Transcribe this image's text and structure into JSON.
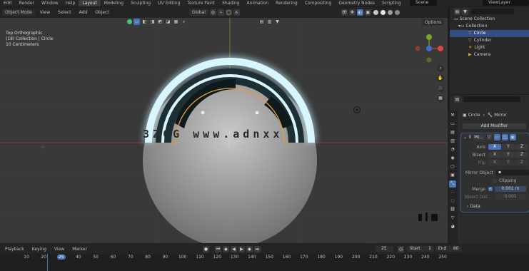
{
  "menu": {
    "items": [
      "Edit",
      "Render",
      "Window",
      "Help"
    ],
    "workspaces": [
      "Layout",
      "Modeling",
      "Sculpting",
      "UV Editing",
      "Texture Paint",
      "Shading",
      "Animation",
      "Rendering",
      "Compositing",
      "Geometry Nodes",
      "Scripting"
    ],
    "active_workspace": "Layout",
    "scene": "Scene",
    "view_layer": "ViewLayer"
  },
  "viewport_header": {
    "mode": "Object Mode",
    "menus": [
      "View",
      "Select",
      "Add",
      "Object"
    ],
    "transform_orientation": "Global",
    "options": "Options"
  },
  "viewport_overlay": {
    "line1": "Top Orthographic",
    "line2": "(18) Collection | Circle",
    "line3": "10 Centimeters",
    "watermark": "3ZCG www.adnxx"
  },
  "outliner": {
    "root": "Scene Collection",
    "collection": "Collection",
    "items": [
      {
        "name": "Circle",
        "selected": true
      },
      {
        "name": "Cylinder",
        "selected": false
      },
      {
        "name": "Light",
        "selected": false
      },
      {
        "name": "Camera",
        "selected": false
      }
    ]
  },
  "properties": {
    "breadcrumb_object": "Circle",
    "breadcrumb_modifier": "Mirror",
    "add_modifier": "Add Modifier",
    "modifier_name": "Mi...",
    "axis_label": "Axis",
    "bisect_label": "Bisect",
    "flip_label": "Flip",
    "axes": [
      "X",
      "Y",
      "Z"
    ],
    "mirror_object_label": "Mirror Object",
    "clipping_label": "Clipping",
    "merge_label": "Merge",
    "merge_value": "0.001 m",
    "bisect_distance_label": "Bisect Dist...",
    "bisect_distance_value": "0.001",
    "data_label": "Data"
  },
  "timeline": {
    "menus": [
      "Playback",
      "Keying",
      "View",
      "Marker"
    ],
    "current_frame": "25",
    "start_label": "Start",
    "start_value": "1",
    "end_label": "End",
    "end_value": "80",
    "ticks": [
      "10",
      "20",
      "25",
      "40",
      "50",
      "60",
      "70",
      "80",
      "90",
      "100",
      "110",
      "120",
      "130",
      "140",
      "150",
      "160",
      "170",
      "180",
      "190",
      "200",
      "210",
      "220",
      "230",
      "240",
      "250"
    ]
  },
  "colors": {
    "accent": "#4772b3",
    "selection_outline": "#e39c3d",
    "glow": "#bfefff",
    "object_dark": "#1e2f33"
  }
}
